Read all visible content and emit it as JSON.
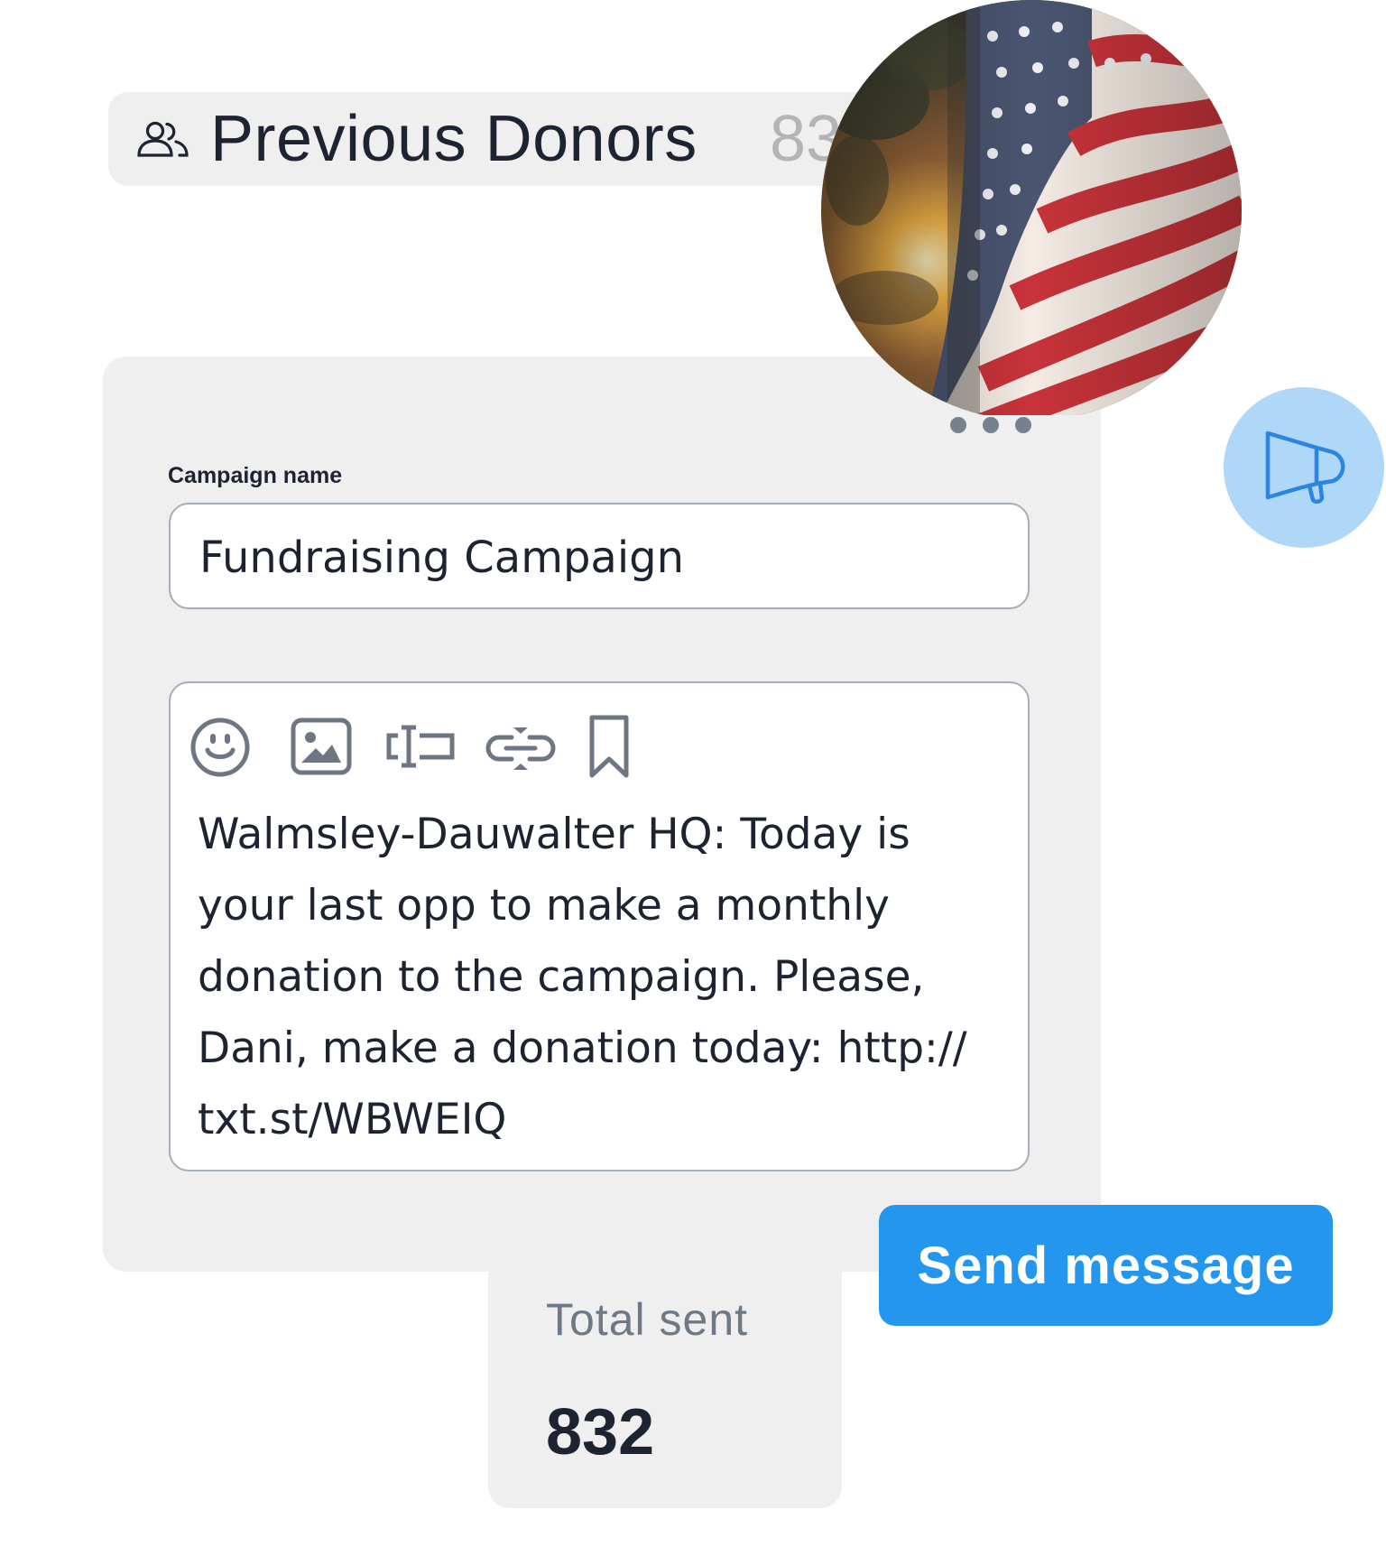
{
  "audience": {
    "icon": "users-icon",
    "title": "Previous Donors",
    "count": "832"
  },
  "campaign": {
    "more_icon": "more-dots-icon",
    "name_label": "Campaign name",
    "name_value": "Fundraising Campaign",
    "toolbar": [
      {
        "icon": "emoji-icon"
      },
      {
        "icon": "image-icon"
      },
      {
        "icon": "text-field-icon"
      },
      {
        "icon": "link-icon"
      },
      {
        "icon": "bookmark-icon"
      }
    ],
    "message": "Walmsley-Dauwalter HQ: Today is your last opp to make a monthly donation to the campaign. Please, Dani, make a donation today: http:// txt.st/WBWEIQ"
  },
  "stats": {
    "total_label": "Total sent",
    "total_value": "832"
  },
  "actions": {
    "send_label": "Send message"
  },
  "decor": {
    "photo": "american-flag-photo",
    "badge_icon": "megaphone-icon"
  },
  "colors": {
    "accent": "#2496ee",
    "badge": "#afd7f8",
    "card": "#efefef",
    "border": "#a5aebb",
    "icon_gray": "#6e7684"
  }
}
